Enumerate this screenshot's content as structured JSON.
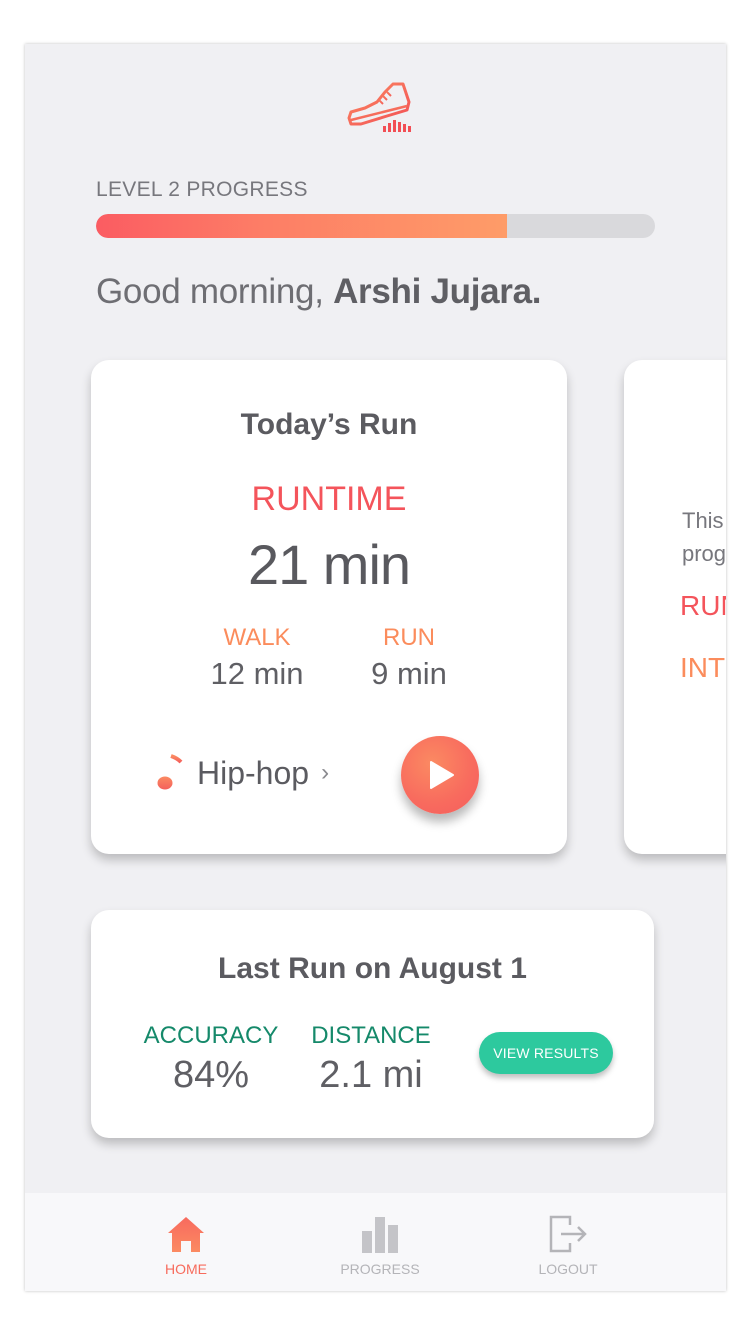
{
  "header": {
    "logo_icon": "running-shoe-icon",
    "level_label": "LEVEL 2 PROGRESS",
    "level_progress": 0.735
  },
  "greeting": {
    "prefix": "Good morning,",
    "name": "Arshi Jujara."
  },
  "todays_run": {
    "title": "Today’s Run",
    "runtime_label": "RUNTIME",
    "runtime_value": "21 min",
    "walk_label": "WALK",
    "walk_value": "12 min",
    "run_label": "RUN",
    "run_value": "9 min",
    "music_icon": "music-note-icon",
    "music_genre": "Hip-hop",
    "music_chevron": "›",
    "play_icon": "play-icon"
  },
  "next_card": {
    "line1": "This",
    "line2": "prog",
    "label1": "RUN",
    "label2": "INT"
  },
  "last_run": {
    "title": "Last Run on August 1",
    "accuracy_label": "ACCURACY",
    "accuracy_value": "84%",
    "distance_label": "DISTANCE",
    "distance_value": "2.1 mi",
    "view_button": "VIEW RESULTS"
  },
  "tabbar": {
    "home": {
      "label": "HOME",
      "icon": "home-icon",
      "active": true
    },
    "progress": {
      "label": "PROGRESS",
      "icon": "bar-chart-icon",
      "active": false
    },
    "logout": {
      "label": "LOGOUT",
      "icon": "logout-icon",
      "active": false
    }
  },
  "colors": {
    "accent_red": "#f4545b",
    "accent_orange": "#fb8c5c",
    "accent_green": "#15896a",
    "button_green": "#2dc99e",
    "background": "#f0f0f3"
  }
}
